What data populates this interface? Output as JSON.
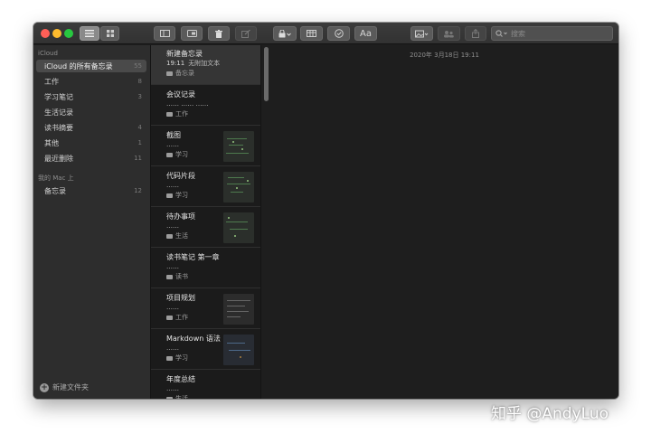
{
  "toolbar": {
    "search_placeholder": "搜索",
    "format_label": "Aa"
  },
  "sidebar": {
    "section_icloud": "iCloud",
    "section_local": "我的 Mac 上",
    "icloud_folders": [
      {
        "label": "iCloud 的所有备忘录",
        "count": "55"
      },
      {
        "label": "工作",
        "count": "8"
      },
      {
        "label": "学习笔记",
        "count": "3"
      },
      {
        "label": "生活记录",
        "count": ""
      },
      {
        "label": "读书摘要",
        "count": "4"
      },
      {
        "label": "其他",
        "count": "1"
      },
      {
        "label": "最近删除",
        "count": "11"
      }
    ],
    "local_folders": [
      {
        "label": "备忘录",
        "count": "12"
      }
    ],
    "new_folder_label": "新建文件夹"
  },
  "notes": [
    {
      "title": "新建备忘录",
      "time": "19:11",
      "preview": "无附加文本",
      "folder": "备忘录"
    },
    {
      "title": "会议记录",
      "time": "",
      "preview": "…… …… ……",
      "folder": "工作"
    },
    {
      "title": "截图",
      "time": "",
      "preview": "……",
      "folder": "学习"
    },
    {
      "title": "代码片段",
      "time": "",
      "preview": "……",
      "folder": "学习"
    },
    {
      "title": "待办事项",
      "time": "",
      "preview": "……",
      "folder": "生活"
    },
    {
      "title": "读书笔记 第一章",
      "time": "",
      "preview": "……",
      "folder": "读书"
    },
    {
      "title": "项目规划",
      "time": "",
      "preview": "……",
      "folder": "工作"
    },
    {
      "title": "Markdown 语法",
      "time": "",
      "preview": "……",
      "folder": "学习"
    },
    {
      "title": "年度总结",
      "time": "",
      "preview": "……",
      "folder": "生活"
    }
  ],
  "editor": {
    "date": "2020年 3月18日 19:11"
  },
  "watermark": "知乎 @AndyLuo",
  "colors": {
    "window_bg": "#1e1e1e",
    "sidebar_bg": "#2d2d2d",
    "selection": "#4a4a4a",
    "close": "#ff5f57",
    "minimize": "#febc2e",
    "maximize": "#28c840"
  }
}
